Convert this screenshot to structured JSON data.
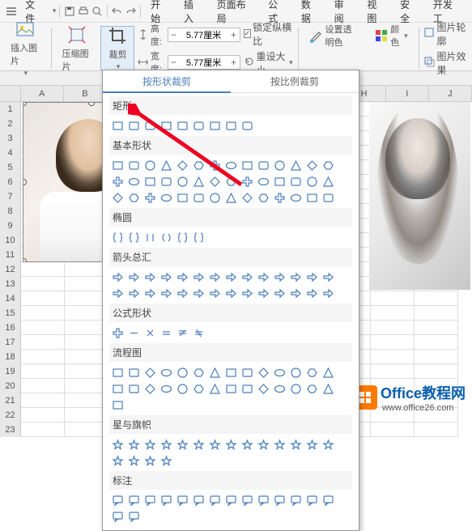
{
  "menubar": {
    "file": "文件",
    "tabs": [
      "开始",
      "插入",
      "页面布局",
      "公式",
      "数据",
      "审阅",
      "视图",
      "安全",
      "开发工"
    ]
  },
  "toolbar": {
    "insert_pic": "插入图片",
    "compress_pic": "压缩图片",
    "crop": "裁剪",
    "height_label": "高度:",
    "width_label": "宽度:",
    "height_val": "5.77厘米",
    "width_val": "5.77厘米",
    "lock_ratio": "锁定纵横比",
    "reset_size": "重设大小",
    "transparent": "设置透明色",
    "color": "颜色",
    "pic_outline": "图片轮廓",
    "pic_effect": "图片效果"
  },
  "dropdown": {
    "tab1": "按形状裁剪",
    "tab2": "按比例裁剪",
    "sections": {
      "rect": "矩形",
      "basic": "基本形状",
      "oval": "椭圆",
      "arrows": "箭头总汇",
      "formula": "公式形状",
      "flowchart": "流程图",
      "stars": "星与旗帜",
      "callout": "标注"
    }
  },
  "columns": [
    "A",
    "B",
    "H",
    "I",
    "J"
  ],
  "watermark": {
    "text": "Office教程网",
    "url": "www.office26.com"
  }
}
